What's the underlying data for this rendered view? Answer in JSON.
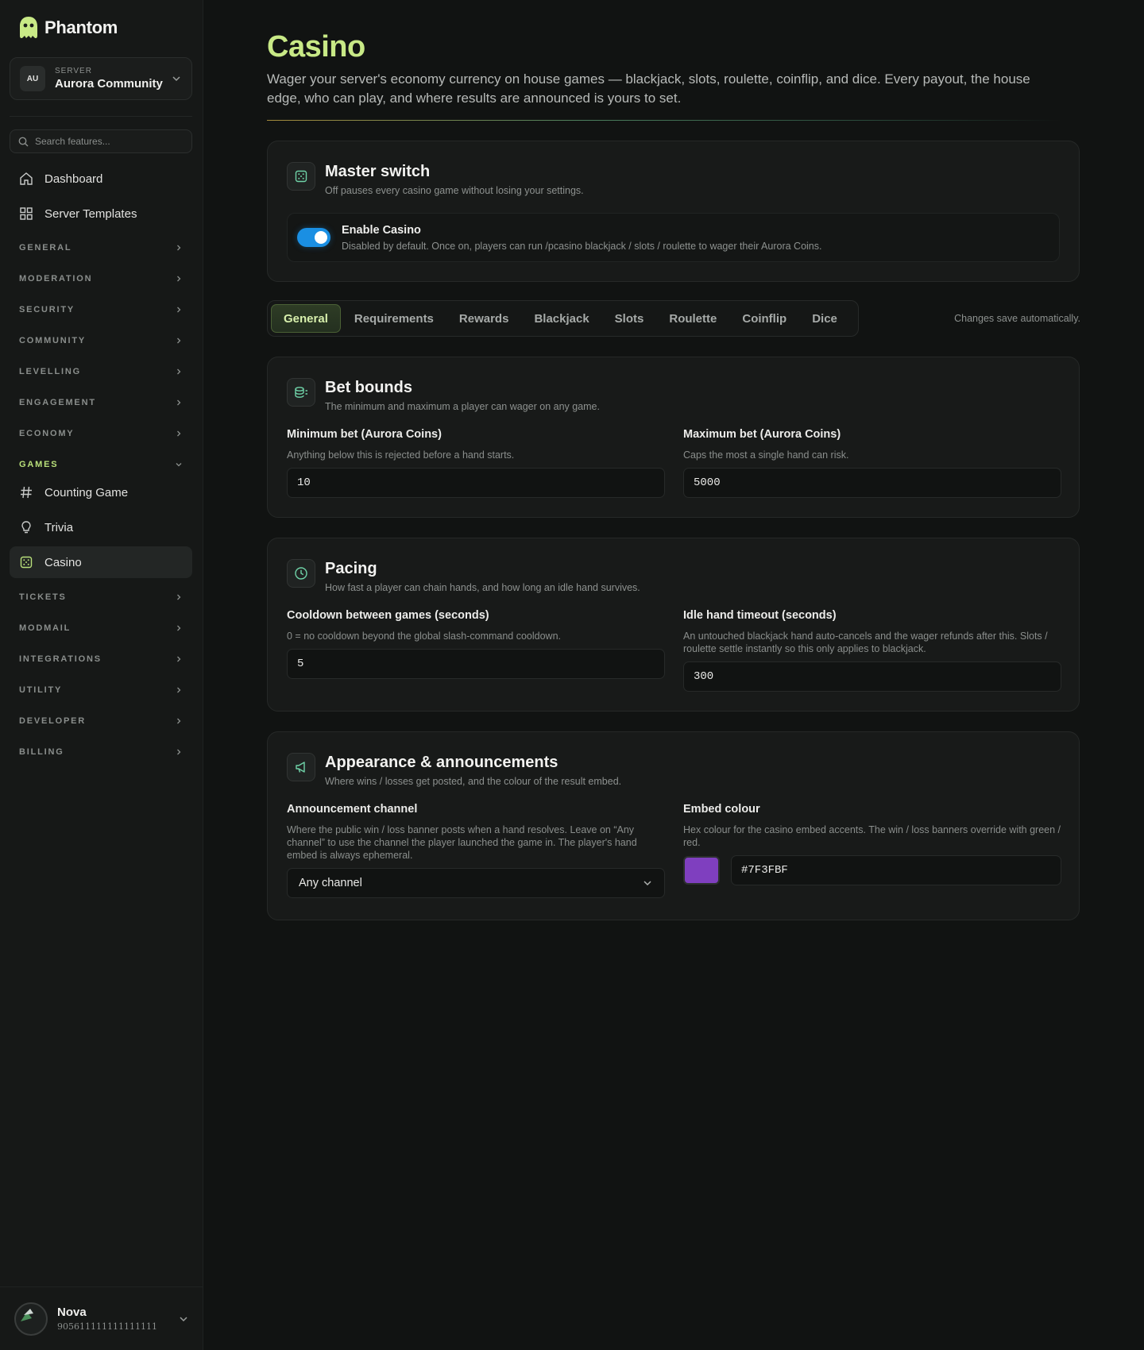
{
  "app": {
    "name": "Phantom"
  },
  "server": {
    "label": "SERVER",
    "avatar": "AU",
    "name": "Aurora Community"
  },
  "search": {
    "placeholder": "Search features..."
  },
  "nav": {
    "dashboard": "Dashboard",
    "templates": "Server Templates",
    "sections": [
      "GENERAL",
      "MODERATION",
      "SECURITY",
      "COMMUNITY",
      "LEVELLING",
      "ENGAGEMENT",
      "ECONOMY"
    ],
    "games": {
      "label": "GAMES",
      "items": [
        "Counting Game",
        "Trivia",
        "Casino"
      ]
    },
    "sections_after": [
      "TICKETS",
      "MODMAIL",
      "INTEGRATIONS",
      "UTILITY",
      "DEVELOPER",
      "BILLING"
    ]
  },
  "user": {
    "name": "Nova",
    "id": "905611111111111111"
  },
  "page": {
    "title": "Casino",
    "description": "Wager your server's economy currency on house games — blackjack, slots, roulette, coinflip, and dice. Every payout, the house edge, who can play, and where results are announced is yours to set."
  },
  "master": {
    "title": "Master switch",
    "subtitle": "Off pauses every casino game without losing your settings.",
    "toggle_label": "Enable Casino",
    "toggle_desc": "Disabled by default. Once on, players can run /pcasino blackjack / slots / roulette to wager their Aurora Coins.",
    "enabled": true
  },
  "tabs": [
    "General",
    "Requirements",
    "Rewards",
    "Blackjack",
    "Slots",
    "Roulette",
    "Coinflip",
    "Dice"
  ],
  "autosave": "Changes save automatically.",
  "bet_bounds": {
    "title": "Bet bounds",
    "subtitle": "The minimum and maximum a player can wager on any game.",
    "min_label": "Minimum bet (Aurora Coins)",
    "min_help": "Anything below this is rejected before a hand starts.",
    "min_value": "10",
    "max_label": "Maximum bet (Aurora Coins)",
    "max_help": "Caps the most a single hand can risk.",
    "max_value": "5000"
  },
  "pacing": {
    "title": "Pacing",
    "subtitle": "How fast a player can chain hands, and how long an idle hand survives.",
    "cooldown_label": "Cooldown between games (seconds)",
    "cooldown_help": "0 = no cooldown beyond the global slash-command cooldown.",
    "cooldown_value": "5",
    "idle_label": "Idle hand timeout (seconds)",
    "idle_help": "An untouched blackjack hand auto-cancels and the wager refunds after this. Slots / roulette settle instantly so this only applies to blackjack.",
    "idle_value": "300"
  },
  "appearance": {
    "title": "Appearance & announcements",
    "subtitle": "Where wins / losses get posted, and the colour of the result embed.",
    "channel_label": "Announcement channel",
    "channel_help": "Where the public win / loss banner posts when a hand resolves. Leave on “Any channel” to use the channel the player launched the game in. The player's hand embed is always ephemeral.",
    "channel_value": "Any channel",
    "colour_label": "Embed colour",
    "colour_help": "Hex colour for the casino embed accents. The win / loss banners override with green / red.",
    "colour_value": "#7F3FBF"
  },
  "colors": {
    "accent": "#c8e986",
    "toggle_on": "#1a8fe3",
    "embed_swatch": "#7F3FBF"
  }
}
